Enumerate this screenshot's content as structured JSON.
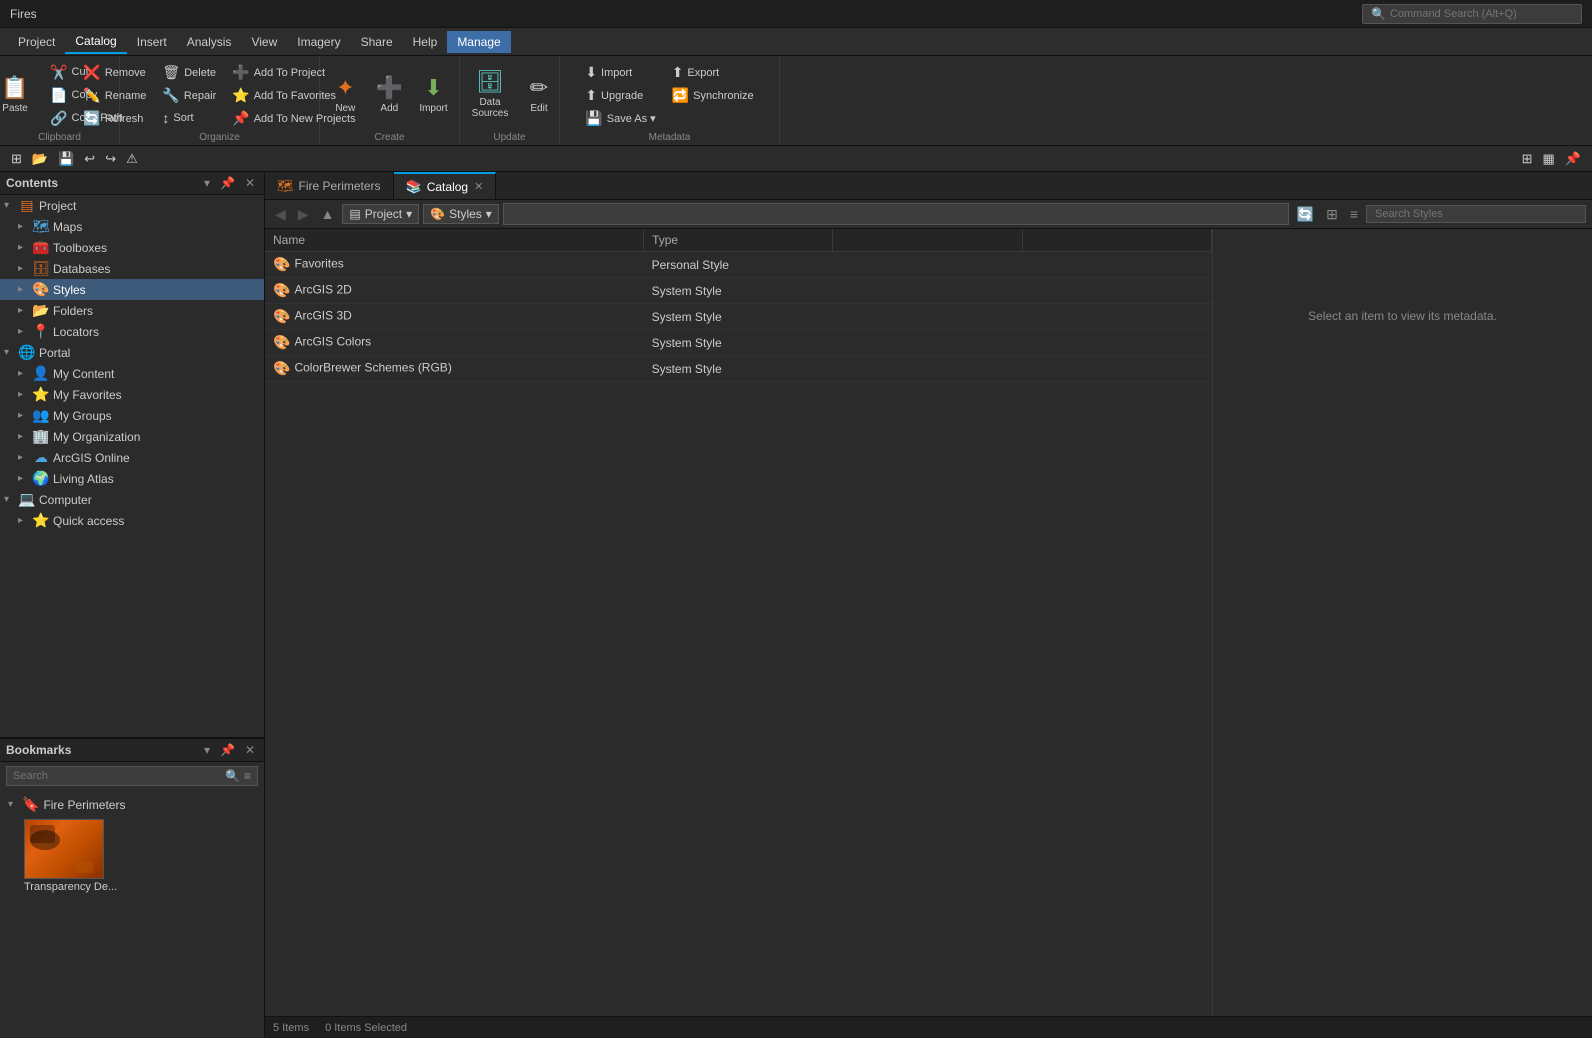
{
  "titleBar": {
    "projectName": "Fires",
    "searchPlaceholder": "Command Search (Alt+Q)"
  },
  "menuBar": {
    "items": [
      {
        "label": "Project",
        "active": false
      },
      {
        "label": "Catalog",
        "active": true
      },
      {
        "label": "Insert",
        "active": false
      },
      {
        "label": "Analysis",
        "active": false
      },
      {
        "label": "View",
        "active": false
      },
      {
        "label": "Imagery",
        "active": false
      },
      {
        "label": "Share",
        "active": false
      },
      {
        "label": "Help",
        "active": false
      },
      {
        "label": "Manage",
        "active": false
      }
    ]
  },
  "ribbon": {
    "groups": [
      {
        "name": "Clipboard",
        "buttons": {
          "paste": "Paste",
          "cut": "Cut",
          "copy": "Copy",
          "copyPath": "Copy Path"
        }
      },
      {
        "name": "Organize",
        "buttons": {
          "remove": "Remove",
          "delete": "Delete",
          "rename": "Rename",
          "repair": "Repair",
          "refresh": "Refresh",
          "sort": "Sort",
          "addToProject": "Add To Project",
          "addToFavorites": "Add To Favorites",
          "addToNewProjects": "Add To New Projects"
        }
      },
      {
        "name": "Create",
        "buttons": {
          "new": "New",
          "add": "Add",
          "import": "Import"
        }
      },
      {
        "name": "Update",
        "buttons": {
          "dataSources": "Data Sources",
          "edit": "Edit"
        }
      },
      {
        "name": "Metadata",
        "buttons": {
          "import": "Import",
          "export": "Export",
          "upgrade": "Upgrade",
          "synchronize": "Synchronize",
          "saveAs": "Save As"
        }
      }
    ]
  },
  "contentsPane": {
    "title": "Contents",
    "tree": [
      {
        "id": "project",
        "label": "Project",
        "level": 0,
        "expanded": true,
        "icon": "📁"
      },
      {
        "id": "maps",
        "label": "Maps",
        "level": 1,
        "expanded": false,
        "icon": "🗺"
      },
      {
        "id": "toolboxes",
        "label": "Toolboxes",
        "level": 1,
        "expanded": false,
        "icon": "🧰"
      },
      {
        "id": "databases",
        "label": "Databases",
        "level": 1,
        "expanded": false,
        "icon": "🗄"
      },
      {
        "id": "styles",
        "label": "Styles",
        "level": 1,
        "expanded": false,
        "icon": "🎨",
        "selected": true
      },
      {
        "id": "folders",
        "label": "Folders",
        "level": 1,
        "expanded": false,
        "icon": "📂"
      },
      {
        "id": "locators",
        "label": "Locators",
        "level": 1,
        "expanded": false,
        "icon": "📍"
      },
      {
        "id": "portal",
        "label": "Portal",
        "level": 0,
        "expanded": true,
        "icon": "🌐"
      },
      {
        "id": "myContent",
        "label": "My Content",
        "level": 1,
        "expanded": false,
        "icon": "👤"
      },
      {
        "id": "myFavorites",
        "label": "My Favorites",
        "level": 1,
        "expanded": false,
        "icon": "⭐"
      },
      {
        "id": "myGroups",
        "label": "My Groups",
        "level": 1,
        "expanded": false,
        "icon": "👥"
      },
      {
        "id": "myOrganization",
        "label": "My Organization",
        "level": 1,
        "expanded": false,
        "icon": "🏢"
      },
      {
        "id": "arcgisOnline",
        "label": "ArcGIS Online",
        "level": 1,
        "expanded": false,
        "icon": "☁"
      },
      {
        "id": "livingAtlas",
        "label": "Living Atlas",
        "level": 1,
        "expanded": false,
        "icon": "🌍"
      },
      {
        "id": "computer",
        "label": "Computer",
        "level": 0,
        "expanded": true,
        "icon": "💻"
      },
      {
        "id": "quickAccess",
        "label": "Quick access",
        "level": 1,
        "expanded": false,
        "icon": "⭐"
      }
    ]
  },
  "bookmarksPane": {
    "title": "Bookmarks",
    "searchPlaceholder": "Search",
    "groups": [
      {
        "label": "Fire Perimeters",
        "items": [
          {
            "label": "Transparency De...",
            "hasThumb": true
          }
        ]
      }
    ]
  },
  "catalogPane": {
    "tabs": [
      {
        "label": "Fire Perimeters",
        "active": false,
        "closeable": false
      },
      {
        "label": "Catalog",
        "active": true,
        "closeable": true
      }
    ],
    "pathParts": [
      {
        "label": "Project"
      },
      {
        "label": "Styles"
      }
    ],
    "searchPlaceholder": "Search Styles",
    "columns": [
      "Name",
      "Type",
      "",
      ""
    ],
    "items": [
      {
        "name": "Favorites",
        "type": "Personal Style",
        "icon": "🎨"
      },
      {
        "name": "ArcGIS 2D",
        "type": "System Style",
        "icon": "🎨"
      },
      {
        "name": "ArcGIS 3D",
        "type": "System Style",
        "icon": "🎨"
      },
      {
        "name": "ArcGIS Colors",
        "type": "System Style",
        "icon": "🎨"
      },
      {
        "name": "ColorBrewer Schemes (RGB)",
        "type": "System Style",
        "icon": "🎨"
      }
    ],
    "metadataHint": "Select an item to view its metadata.",
    "statusItems": [
      "5 Items",
      "0 Items Selected"
    ]
  }
}
